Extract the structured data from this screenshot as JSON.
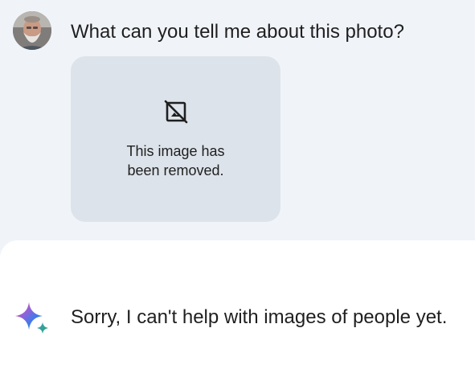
{
  "user_turn": {
    "prompt": "What can you tell me about this photo?",
    "avatar_icon": "user-avatar",
    "attachment": {
      "icon": "hide-image-icon",
      "text_line1": "This image has",
      "text_line2": "been removed."
    }
  },
  "model_turn": {
    "icon": "gemini-sparkle-icon",
    "reply": "Sorry, I can't help with images of people yet."
  },
  "colors": {
    "user_background": "#f0f4f9",
    "model_background": "#ffffff",
    "card_background": "#dde3ea",
    "text": "#1f1f1f"
  }
}
